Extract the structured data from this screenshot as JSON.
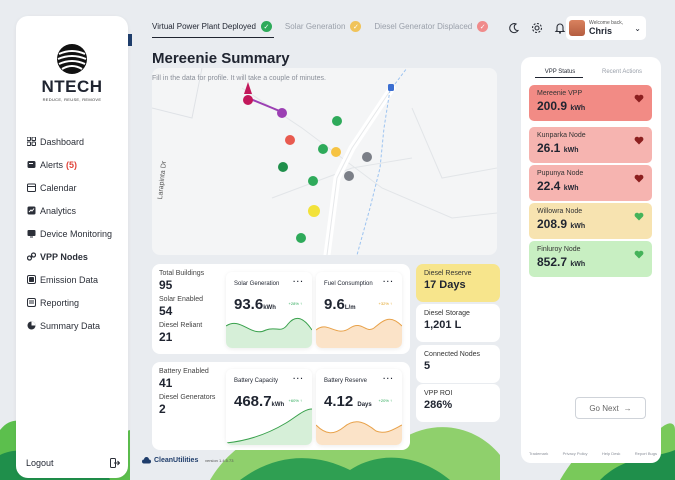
{
  "brand": {
    "name": "NTECH",
    "tagline": "REDUCE, REUSE, REMOVE"
  },
  "nav": {
    "items": [
      {
        "label": "Dashboard",
        "icon": "grid-icon"
      },
      {
        "label": "Alerts",
        "count": "(5)",
        "icon": "alert-icon"
      },
      {
        "label": "Calendar",
        "icon": "calendar-icon"
      },
      {
        "label": "Analytics",
        "icon": "analytics-icon"
      },
      {
        "label": "Device Monitoring",
        "icon": "device-icon"
      },
      {
        "label": "VPP Nodes",
        "icon": "link-icon",
        "active": true
      },
      {
        "label": "Emission Data",
        "icon": "emission-icon"
      },
      {
        "label": "Reporting",
        "icon": "report-icon"
      },
      {
        "label": "Summary Data",
        "icon": "pie-icon"
      }
    ],
    "logout": "Logout"
  },
  "steps": [
    {
      "label": "Virtual Power Plant Deployed",
      "status": "done",
      "color": "#2eaa5a"
    },
    {
      "label": "Solar Generation",
      "status": "pending",
      "color": "#f0c35a"
    },
    {
      "label": "Diesel Generator Displaced",
      "status": "pending",
      "color": "#f08b8b"
    }
  ],
  "user": {
    "welcome": "Welcome back,",
    "name": "Chris"
  },
  "page": {
    "title": "Mereenie Summary",
    "subtitle": "Fill in the data for profile. It will take a couple of minutes."
  },
  "map": {
    "street": "Larapinta Dr"
  },
  "stats1": [
    {
      "label": "Total Buildings",
      "value": "95"
    },
    {
      "label": "Solar Enabled",
      "value": "54"
    },
    {
      "label": "Diesel Reliant",
      "value": "21"
    }
  ],
  "stats2": [
    {
      "label": "Battery Enabled",
      "value": "41"
    },
    {
      "label": "Diesel Generators",
      "value": "2"
    }
  ],
  "minis": [
    {
      "title": "Solar Generation",
      "value": "93.6",
      "unit": "kWh",
      "change": "+28% ↑"
    },
    {
      "title": "Fuel Consumption",
      "value": "9.6",
      "unit": "L/m",
      "change": "+32% ↑"
    },
    {
      "title": "Battery Capacity",
      "value": "468.7",
      "unit": "kWh",
      "change": "+60% ↑"
    },
    {
      "title": "Battery Reserve",
      "value": "4.12",
      "unit": "Days",
      "change": "+20% ↑"
    }
  ],
  "right_cards": [
    {
      "label": "Diesel Reserve",
      "value": "17 Days",
      "color": "#f7e58c"
    },
    {
      "label": "Diesel Storage",
      "value": "1,201 L",
      "color": "#ffffff"
    },
    {
      "label": "Connected Nodes",
      "value": "5",
      "color": "#ffffff"
    },
    {
      "label": "VPP ROI",
      "value": "286%",
      "color": "#ffffff"
    }
  ],
  "vpp": {
    "tabs": [
      "VPP Status",
      "Recent Actions"
    ],
    "nodes": [
      {
        "name": "Mereenie VPP",
        "value": "200.9",
        "unit": "kWh",
        "color": "#f28b85",
        "heart": "#8c1f1f"
      },
      {
        "name": "Kunparka Node",
        "value": "26.1",
        "unit": "kWh",
        "color": "#f6b4b0",
        "heart": "#8c1f1f"
      },
      {
        "name": "Pupunya Node",
        "value": "22.4",
        "unit": "kWh",
        "color": "#f6b4b0",
        "heart": "#8c1f1f"
      },
      {
        "name": "Willowra Node",
        "value": "208.9",
        "unit": "kWh",
        "color": "#f7e3b0",
        "heart": "#45b35a"
      },
      {
        "name": "Finluroy Node",
        "value": "852.7",
        "unit": "kWh",
        "color": "#c8efc2",
        "heart": "#45b35a"
      }
    ],
    "go_next": "Go Next",
    "footer": [
      "Trademark",
      "Privacy Policy",
      "Help Desk",
      "Report Bugs"
    ]
  },
  "footer": {
    "brand": "CleanUtilities",
    "version": "version 1.4.5.73"
  }
}
